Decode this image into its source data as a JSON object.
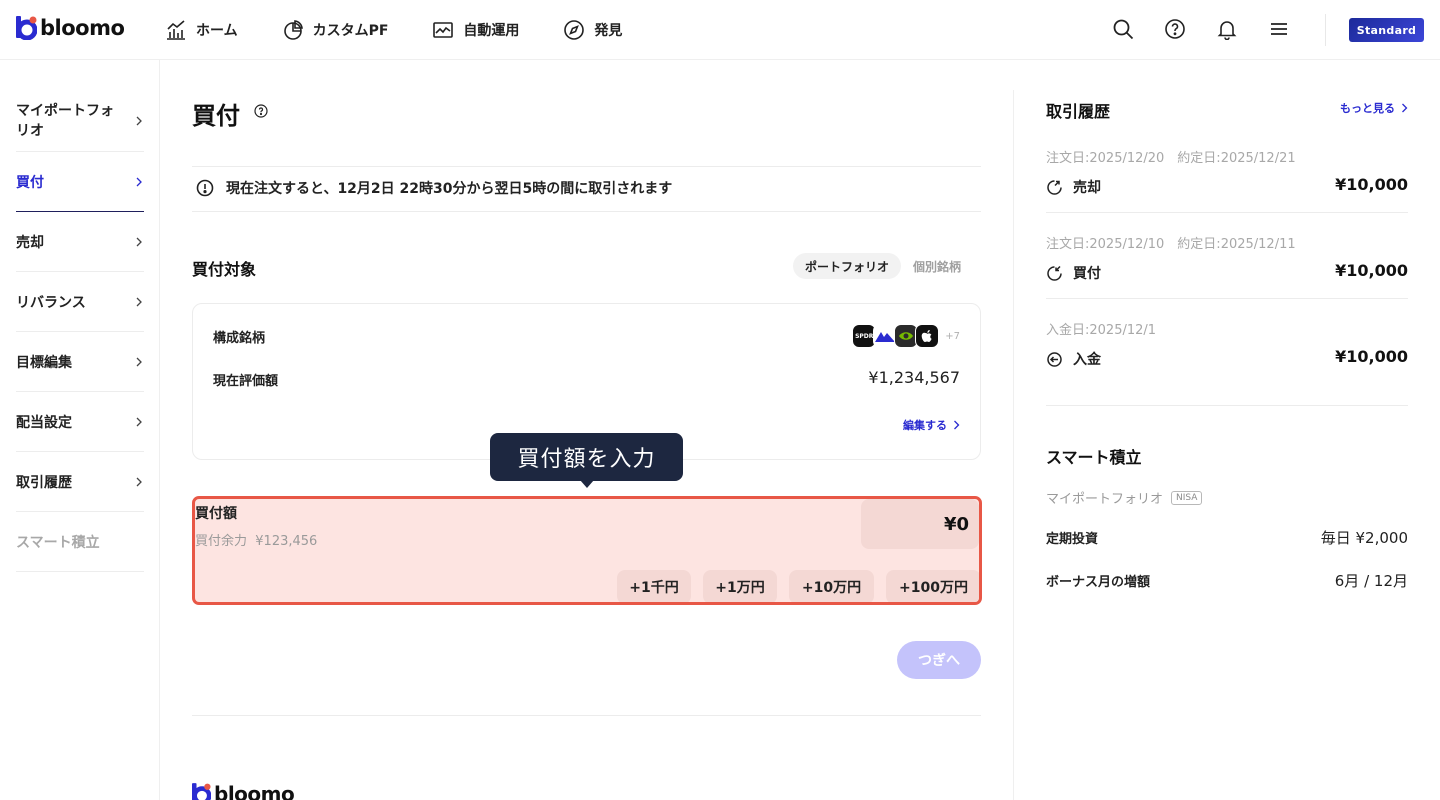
{
  "brand": {
    "name": "bloomo",
    "accent": "#2a2bd0",
    "highlight": "#e85746"
  },
  "header": {
    "nav": [
      {
        "label": "ホーム",
        "icon": "chart-icon"
      },
      {
        "label": "カスタムPF",
        "icon": "pie-icon"
      },
      {
        "label": "自動運用",
        "icon": "trend-icon"
      },
      {
        "label": "発見",
        "icon": "compass-icon"
      }
    ],
    "plan": "Standard"
  },
  "sidebar": {
    "items": [
      {
        "label": "マイポートフォリオ"
      },
      {
        "label": "買付"
      },
      {
        "label": "売却"
      },
      {
        "label": "リバランス"
      },
      {
        "label": "目標編集"
      },
      {
        "label": "配当設定"
      },
      {
        "label": "取引履歴"
      },
      {
        "label": "スマート積立"
      }
    ]
  },
  "main": {
    "title": "買付",
    "notice": "現在注文すると、12月2日 22時30分から翌日5時の間に取引されます",
    "target_title": "買付対象",
    "segments": [
      "ポートフォリオ",
      "個別銘柄"
    ],
    "card": {
      "holdings_label": "構成銘柄",
      "stock_icons": [
        "SPDR",
        "",
        "",
        ""
      ],
      "more_count": "+7",
      "value_label": "現在評価額",
      "value": "¥1,234,567",
      "edit": "編集する"
    },
    "tooltip": "買付額を入力",
    "amount": {
      "label": "買付額",
      "available_label": "買付余力",
      "available_value": "¥123,456",
      "value": "¥0",
      "chips": [
        "+1千円",
        "+1万円",
        "+10万円",
        "+100万円"
      ]
    },
    "next": "つぎへ"
  },
  "right": {
    "history_title": "取引履歴",
    "more": "もっと見る",
    "transactions": [
      {
        "date": "注文日:2025/12/20　約定日:2025/12/21",
        "type": "売却",
        "amount": "¥10,000"
      },
      {
        "date": "注文日:2025/12/10　約定日:2025/12/11",
        "type": "買付",
        "amount": "¥10,000"
      },
      {
        "date": "入金日:2025/12/1",
        "type": "入金",
        "amount": "¥10,000"
      }
    ],
    "smart_title": "スマート積立",
    "portfolio_name": "マイポートフォリオ",
    "nisa": "NISA",
    "rows": [
      {
        "k": "定期投資",
        "v": "毎日 ¥2,000"
      },
      {
        "k": "ボーナス月の増額",
        "v": "6月 / 12月"
      }
    ]
  }
}
